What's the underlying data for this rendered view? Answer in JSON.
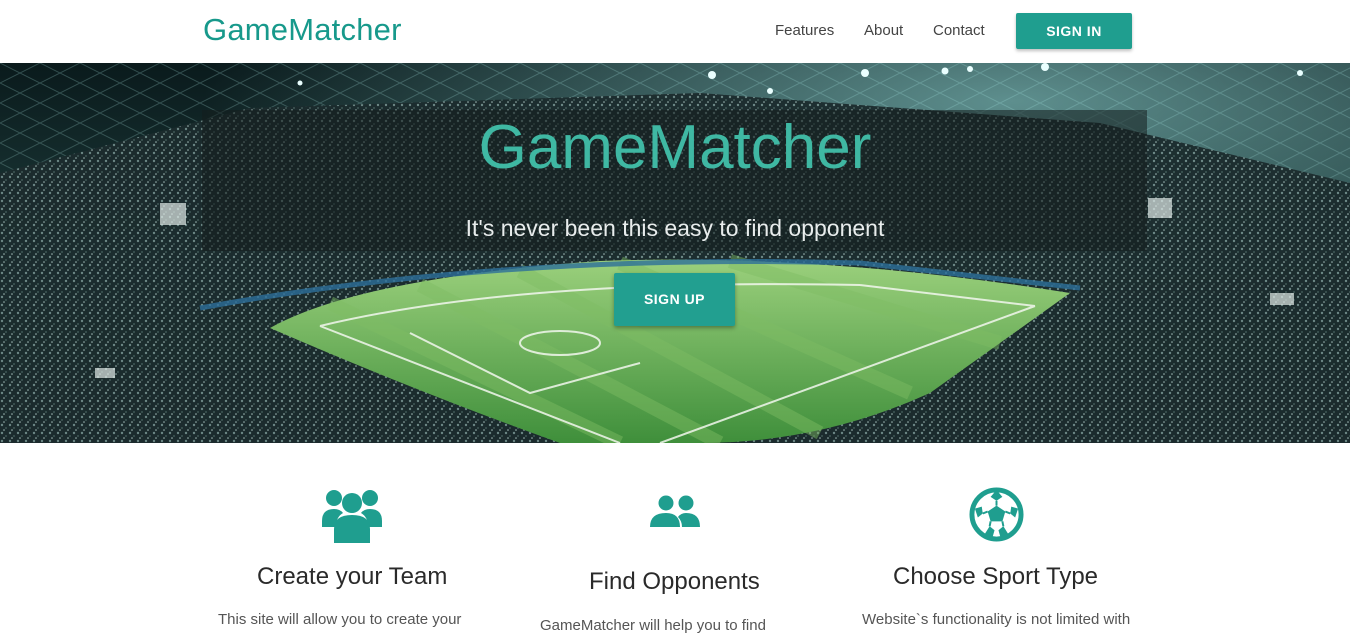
{
  "nav": {
    "brand": "GameMatcher",
    "links": [
      "Features",
      "About",
      "Contact"
    ],
    "signin_label": "SIGN IN"
  },
  "hero": {
    "title": "GameMatcher",
    "subtitle": "It's never been this easy to find opponent",
    "signup_label": "SIGN UP"
  },
  "features": [
    {
      "icon": "team-icon",
      "title": "Create your Team",
      "text": "This site will allow you to create your"
    },
    {
      "icon": "opponents-icon",
      "title": "Find Opponents",
      "text": "GameMatcher will help you to find"
    },
    {
      "icon": "soccer-ball-icon",
      "title": "Choose Sport Type",
      "text": "Website`s functionality is not limited with"
    }
  ],
  "colors": {
    "accent": "#1f9e8f",
    "brand_text": "#17998b",
    "hero_title": "#3fb8a3"
  }
}
